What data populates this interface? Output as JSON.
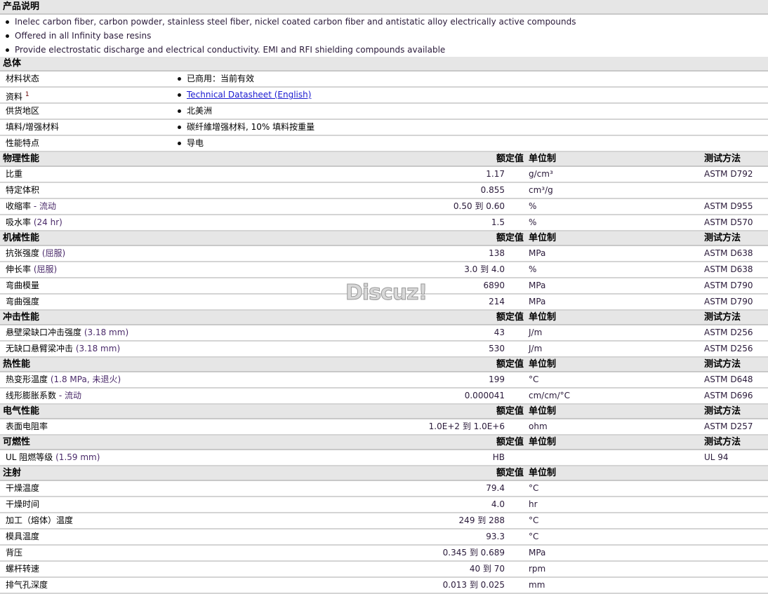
{
  "description": {
    "title": "产品说明",
    "bullets": [
      "Inelec carbon fiber, carbon powder, stainless steel fiber, nickel coated carbon fiber and antistatic alloy electrically active compounds",
      "Offered in all Infinity base resins",
      "Provide electrostatic discharge and electrical conductivity. EMI and RFI shielding compounds available"
    ]
  },
  "general": {
    "title": "总体",
    "rows": [
      {
        "name": "材料状态",
        "value": "已商用：当前有效"
      },
      {
        "name": "资料",
        "sup": "1",
        "value": "Technical Datasheet (English)",
        "link": true
      },
      {
        "name": "供货地区",
        "value": "北美洲"
      },
      {
        "name": "填料/增强材料",
        "value": "碳纤維增强材料, 10% 填料按重量"
      },
      {
        "name": "性能特点",
        "value": "导电"
      }
    ]
  },
  "col_headers": {
    "value": "额定值",
    "unit": "单位制",
    "test": "测试方法"
  },
  "range_word": "到",
  "sections": [
    {
      "title": "物理性能",
      "test": true,
      "rows": [
        {
          "name": "比重",
          "value": "1.17",
          "unit": "g/cm³",
          "test": "ASTM D792"
        },
        {
          "name": "特定体积",
          "value": "0.855",
          "unit": "cm³/g",
          "test": ""
        },
        {
          "name": "收缩率",
          "cond": " - 流动",
          "value": "0.50 到  0.60",
          "unit": "%",
          "test": "ASTM D955"
        },
        {
          "name": "吸水率",
          "cond": "(24 hr)",
          "value": "1.5",
          "unit": "%",
          "test": "ASTM D570"
        }
      ]
    },
    {
      "title": "机械性能",
      "test": true,
      "rows": [
        {
          "name": "抗张强度",
          "cond": "(屈服)",
          "value": "138",
          "unit": "MPa",
          "test": "ASTM D638"
        },
        {
          "name": "伸长率",
          "cond": "(屈服)",
          "value": "3.0 到  4.0",
          "unit": "%",
          "test": "ASTM D638"
        },
        {
          "name": "弯曲模量",
          "value": "6890",
          "unit": "MPa",
          "test": "ASTM D790"
        },
        {
          "name": "弯曲强度",
          "value": "214",
          "unit": "MPa",
          "test": "ASTM D790"
        }
      ]
    },
    {
      "title": "冲击性能",
      "test": true,
      "rows": [
        {
          "name": "悬壁梁缺口冲击强度",
          "cond": "(3.18 mm)",
          "value": "43",
          "unit": "J/m",
          "test": "ASTM D256"
        },
        {
          "name": "无缺口悬臂梁冲击",
          "cond": "(3.18 mm)",
          "value": "530",
          "unit": "J/m",
          "test": "ASTM D256"
        }
      ]
    },
    {
      "title": "热性能",
      "test": true,
      "rows": [
        {
          "name": "热变形温度",
          "cond": "(1.8 MPa, 未退火)",
          "value": "199",
          "unit": "°C",
          "test": "ASTM D648"
        },
        {
          "name": "线形膨胀系数",
          "cond": " - 流动",
          "value": "0.000041",
          "unit": "cm/cm/°C",
          "test": "ASTM D696"
        }
      ]
    },
    {
      "title": "电气性能",
      "test": true,
      "rows": [
        {
          "name": "表面电阻率",
          "value": "1.0E+2 到  1.0E+6",
          "unit": "ohm",
          "test": "ASTM D257"
        }
      ]
    },
    {
      "title": "可燃性",
      "test": true,
      "rows": [
        {
          "name": "UL 阻燃等级",
          "cond": "(1.59 mm)",
          "value": "HB",
          "unit": "",
          "test": "UL 94"
        }
      ]
    },
    {
      "title": "注射",
      "test": false,
      "rows": [
        {
          "name": "干燥温度",
          "value": "79.4",
          "unit": "°C"
        },
        {
          "name": "干燥时间",
          "value": "4.0",
          "unit": "hr"
        },
        {
          "name": "加工（熔体）温度",
          "value": "249 到  288",
          "unit": "°C"
        },
        {
          "name": "模具温度",
          "value": "93.3",
          "unit": "°C"
        },
        {
          "name": "背压",
          "value": "0.345 到  0.689",
          "unit": "MPa"
        },
        {
          "name": "螺杆转速",
          "value": "40 到  70",
          "unit": "rpm"
        },
        {
          "name": "排气孔深度",
          "value": "0.013 到  0.025",
          "unit": "mm"
        }
      ]
    }
  ],
  "watermark": "Discuz!"
}
